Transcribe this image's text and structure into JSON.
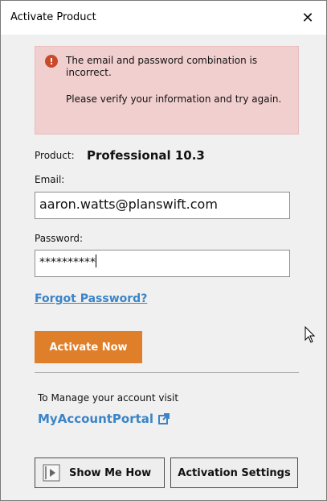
{
  "window": {
    "title": "Activate Product",
    "close_glyph": "✕"
  },
  "error": {
    "icon": "!",
    "line1": "The email and password combination is incorrect.",
    "line2": "Please verify your information and try again.",
    "color": "#f2cfcf"
  },
  "product": {
    "label": "Product:",
    "value": "Professional 10.3"
  },
  "email": {
    "label": "Email:",
    "value": "aaron.watts@planswift.com"
  },
  "password": {
    "label": "Password:",
    "value": "**********"
  },
  "links": {
    "forgot": "Forgot Password?",
    "manage_text": "To Manage your account visit",
    "portal": "MyAccountPortal"
  },
  "buttons": {
    "activate": "Activate Now",
    "show_me_how": "Show Me How",
    "activation_settings": "Activation Settings"
  },
  "colors": {
    "accent": "#e07f2a",
    "link": "#3b84c7",
    "error_icon": "#c94a2a"
  },
  "icons": {
    "close": "close-icon",
    "error": "error-icon",
    "external_link": "external-link-icon",
    "play": "play-icon",
    "cursor": "mouse-cursor-icon"
  }
}
